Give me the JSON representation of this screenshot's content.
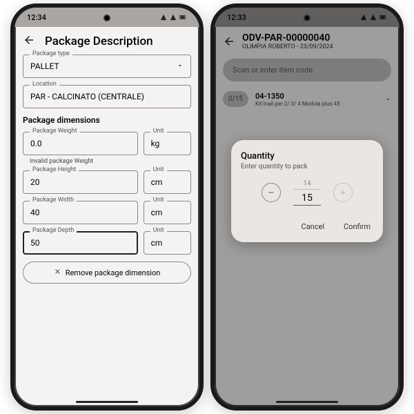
{
  "phone1": {
    "time": "12:34",
    "title": "Package Description",
    "packageType": {
      "label": "Package type",
      "value": "PALLET"
    },
    "location": {
      "label": "Location",
      "value": "PAR - CALCINATO (CENTRALE)"
    },
    "dims_title": "Package dimensions",
    "weight": {
      "label": "Package Weight",
      "value": "0.0",
      "unit_label": "Unit",
      "unit": "kg",
      "error": "Invalid package Weight"
    },
    "height": {
      "label": "Package Height",
      "value": "20",
      "unit_label": "Unit",
      "unit": "cm"
    },
    "width": {
      "label": "Package Width",
      "value": "40",
      "unit_label": "Unit",
      "unit": "cm"
    },
    "depth": {
      "label": "Package Depth",
      "value": "50",
      "unit_label": "Unit",
      "unit": "cm"
    },
    "remove_label": "Remove package dimension"
  },
  "phone2": {
    "time": "12:33",
    "order_id": "ODV-PAR-00000040",
    "order_sub": "OLIMPIA ROBERTO - 23/09/2024",
    "search_placeholder": "Scan or enter item code",
    "item": {
      "qty_chip": "0/15",
      "code": "04-1350",
      "desc": "Kit Inail per 2/ 3/ 4 Modula plus 45"
    },
    "dialog": {
      "title": "Quantity",
      "subtitle": "Enter quantity to pack",
      "top": "14",
      "value": "15",
      "cancel": "Cancel",
      "confirm": "Confirm"
    }
  }
}
